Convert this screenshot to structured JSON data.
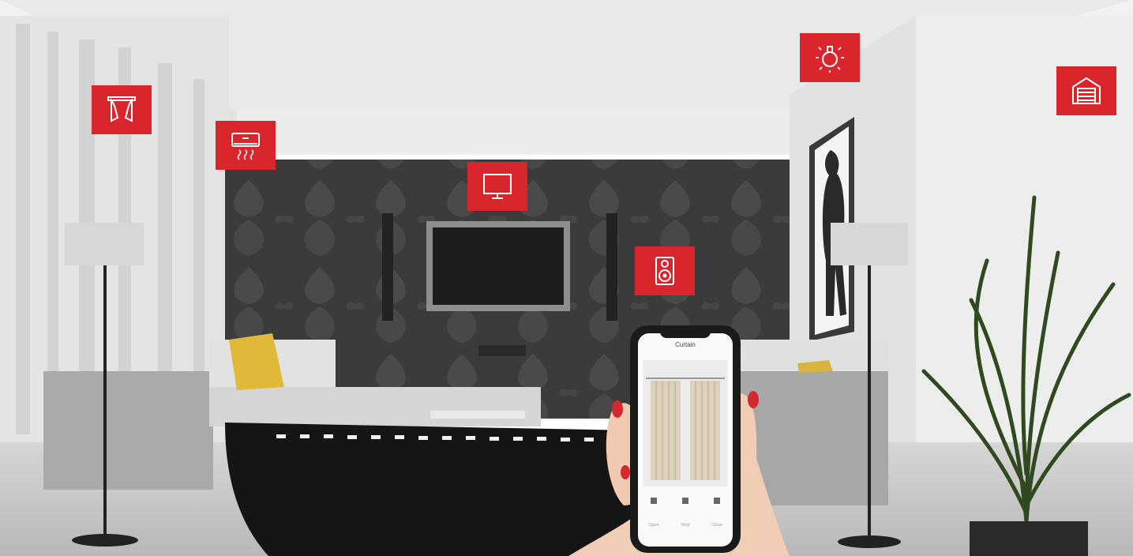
{
  "phone": {
    "screen_title": "Curtain",
    "controls": [
      "Open",
      "Stop",
      "Close"
    ]
  },
  "device_icons": [
    "curtain-icon",
    "air-conditioner-icon",
    "tv-icon",
    "speaker-icon",
    "light-bulb-icon",
    "garage-door-icon"
  ],
  "colors": {
    "accent": "#d9262c",
    "wall": "#3a3a3a",
    "sofa": "#c8c8c8"
  }
}
